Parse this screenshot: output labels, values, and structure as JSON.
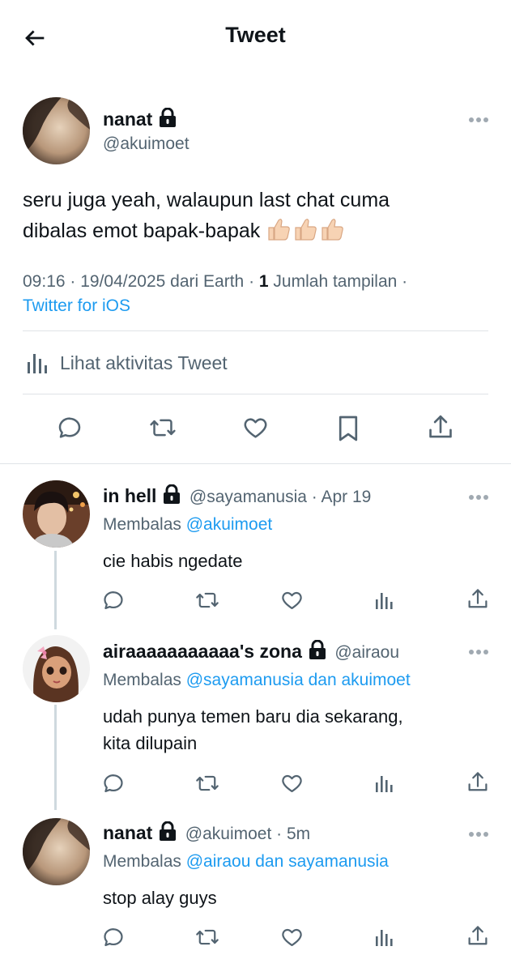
{
  "header": {
    "title": "Tweet"
  },
  "main_tweet": {
    "name": "nanat",
    "handle": "@akuimoet",
    "text_line1": "seru juga yeah, walaupun last chat cuma",
    "text_line2": "dibalas emot bapak-bapak",
    "emojis": [
      "thumbs-up",
      "thumbs-up",
      "thumbs-up"
    ],
    "time": "09:16",
    "sep1": " · ",
    "date": "19/04/2025",
    "from": " dari Earth",
    "sep2": " · ",
    "views_count": "1",
    "views_label": " Jumlah tampilan",
    "sep3": " ·",
    "source": "Twitter for iOS",
    "activity": "Lihat aktivitas Tweet",
    "avatar_colors": [
      "#d9c3a8",
      "#3a2a22"
    ]
  },
  "replies": [
    {
      "name": "in hell",
      "handle": "@sayamanusia",
      "sep": " · ",
      "time": "Apr 19",
      "replying_label": "Membalas ",
      "replying_to": "@akuimoet",
      "text_line1": "cie habis ngedate",
      "text_line2": ""
    },
    {
      "name": "airaaaaaaaaaaa's zona",
      "handle": "@airaou",
      "sep": "",
      "time": "",
      "replying_label": "Membalas ",
      "replying_to": "@sayamanusia dan akuimoet",
      "text_line1": "udah punya temen baru dia sekarang,",
      "text_line2": "kita dilupain"
    },
    {
      "name": "nanat",
      "handle": "@akuimoet",
      "sep": " · ",
      "time": "5m",
      "replying_label": "Membalas ",
      "replying_to": "@airaou dan sayamanusia",
      "text_line1": "stop alay guys",
      "text_line2": ""
    }
  ],
  "colors": {
    "accent": "#1d9bf0",
    "muted": "#536471",
    "divider": "#dfe3e7",
    "thread_line": "#cfd9de"
  }
}
